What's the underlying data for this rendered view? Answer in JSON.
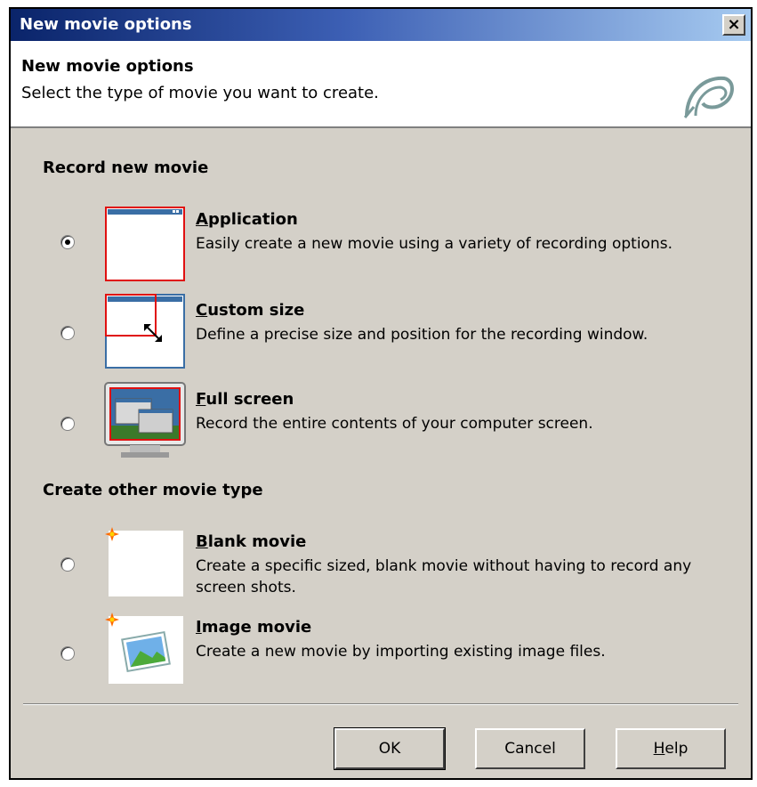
{
  "window": {
    "title": "New movie options",
    "close_glyph": "×"
  },
  "header": {
    "title": "New movie options",
    "subtitle": "Select the type of movie you want to create.",
    "logo_icon": "captivate-logo-icon"
  },
  "sections": {
    "record": {
      "title": "Record new movie",
      "options": [
        {
          "title_mnemonic": "A",
          "title_rest": "pplication",
          "description": "Easily create a new movie using a variety of recording options.",
          "selected": true,
          "icon": "application-window-icon"
        },
        {
          "title_mnemonic": "C",
          "title_rest": "ustom size",
          "description": "Define a precise size and position for the recording window.",
          "selected": false,
          "icon": "custom-size-icon"
        },
        {
          "title_mnemonic": "F",
          "title_rest": "ull screen",
          "description": "Record the entire contents of your computer screen.",
          "selected": false,
          "icon": "full-screen-monitor-icon"
        }
      ]
    },
    "other": {
      "title": "Create other movie type",
      "options": [
        {
          "title_mnemonic": "B",
          "title_rest": "lank movie",
          "description": "Create a specific sized, blank movie without having to record any screen shots.",
          "selected": false,
          "icon": "blank-movie-icon"
        },
        {
          "title_mnemonic": "I",
          "title_rest": "mage movie",
          "description": "Create a new movie by importing existing image files.",
          "selected": false,
          "icon": "image-movie-icon"
        }
      ]
    }
  },
  "buttons": {
    "ok": "OK",
    "cancel": "Cancel",
    "help_mnemonic": "H",
    "help_rest": "elp"
  },
  "colors": {
    "dialog_bg": "#d4d0c8",
    "titlebar_start": "#0a246a",
    "titlebar_end": "#a6caf0",
    "selection_red": "#e01010",
    "thumb_blue": "#3a6ea5"
  }
}
